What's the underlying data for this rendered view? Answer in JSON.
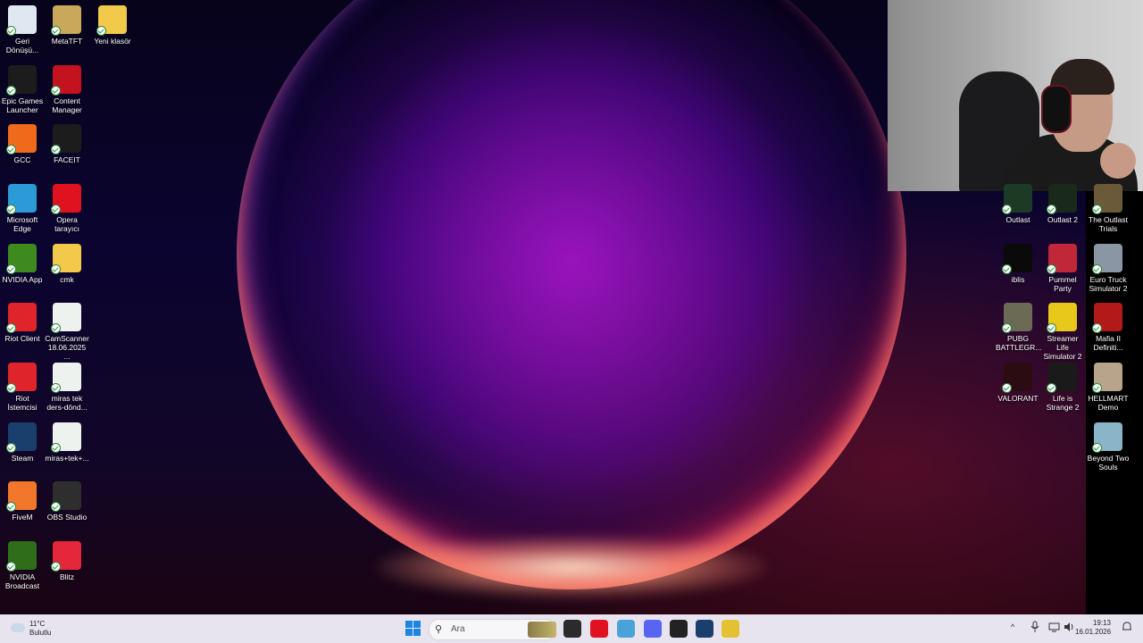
{
  "desktop": {
    "left_icons": [
      {
        "label": "Geri Dönüşü...",
        "icon": "recycle-bin-icon",
        "color": "#dfe8f0"
      },
      {
        "label": "MetaTFT",
        "icon": "metatft-icon",
        "color": "#c8a85a"
      },
      {
        "label": "Yeni klasör",
        "icon": "folder-icon",
        "color": "#f3c94b"
      },
      {
        "label": "Epic Games Launcher",
        "icon": "epic-games-icon",
        "color": "#1c1c1c"
      },
      {
        "label": "Content Manager",
        "icon": "content-manager-icon",
        "color": "#c4121f"
      },
      {
        "label": "GCC",
        "icon": "gcc-icon",
        "color": "#f06a1c"
      },
      {
        "label": "FACEIT",
        "icon": "faceit-icon",
        "color": "#1c1c1c"
      },
      {
        "label": "Microsoft Edge",
        "icon": "edge-icon",
        "color": "#2c9ad6"
      },
      {
        "label": "Opera tarayıcı",
        "icon": "opera-icon",
        "color": "#e0121f"
      },
      {
        "label": "NVIDIA App",
        "icon": "nvidia-icon",
        "color": "#3e8a1e"
      },
      {
        "label": "cmk",
        "icon": "folder-icon",
        "color": "#f3c94b"
      },
      {
        "label": "Riot Client",
        "icon": "riot-icon",
        "color": "#e0242c"
      },
      {
        "label": "CamScanner 18.06.2025 ...",
        "icon": "document-icon",
        "color": "#eef2ee"
      },
      {
        "label": "Riot İstemcisi",
        "icon": "riot-icon",
        "color": "#e0242c"
      },
      {
        "label": "miras tek ders-dönd...",
        "icon": "document-icon",
        "color": "#eef2ee"
      },
      {
        "label": "Steam",
        "icon": "steam-icon",
        "color": "#1b3f6c"
      },
      {
        "label": "miras+tek+...",
        "icon": "document-icon",
        "color": "#eef2ee"
      },
      {
        "label": "FiveM",
        "icon": "fivem-icon",
        "color": "#f2772a"
      },
      {
        "label": "OBS Studio",
        "icon": "obs-icon",
        "color": "#2e2e2e"
      },
      {
        "label": "NVIDIA Broadcast",
        "icon": "nvidia-broadcast-icon",
        "color": "#2f6d1a"
      },
      {
        "label": "Blitz",
        "icon": "blitz-icon",
        "color": "#e5273b"
      }
    ],
    "right_icons": [
      {
        "label": "Outlast",
        "icon": "outlast-icon",
        "color": "#1c3a26"
      },
      {
        "label": "Outlast 2",
        "icon": "outlast2-icon",
        "color": "#1a2a1a"
      },
      {
        "label": "The Outlast Trials",
        "icon": "outlast-trials-icon",
        "color": "#6a5a3a"
      },
      {
        "label": "iblis",
        "icon": "iblis-icon",
        "color": "#0a0a0a"
      },
      {
        "label": "Pummel Party",
        "icon": "pummel-party-icon",
        "color": "#c0283a"
      },
      {
        "label": "Euro Truck Simulator 2",
        "icon": "ets2-icon",
        "color": "#8a96a4"
      },
      {
        "label": "PUBG BATTLEGR...",
        "icon": "pubg-icon",
        "color": "#6b6b55"
      },
      {
        "label": "Streamer Life Simulator 2",
        "icon": "streamer-life-icon",
        "color": "#e8c81a"
      },
      {
        "label": "Mafia II Definiti...",
        "icon": "mafia-icon",
        "color": "#b21a1a"
      },
      {
        "label": "VALORANT",
        "icon": "valorant-icon",
        "color": "#2a0c12"
      },
      {
        "label": "Life is Strange 2",
        "icon": "life-is-strange-icon",
        "color": "#1a1a1a"
      },
      {
        "label": "HELLMART Demo",
        "icon": "hellmart-icon",
        "color": "#b8a48a"
      },
      {
        "label": "Beyond Two Souls",
        "icon": "beyond-two-souls-icon",
        "color": "#8ab4c8"
      }
    ]
  },
  "taskbar": {
    "weather": {
      "temp": "11°C",
      "condition": "Bulutlu"
    },
    "search_placeholder": "Ara",
    "pinned": [
      {
        "icon": "file-explorer-icon",
        "color": "#2b2b2b"
      },
      {
        "icon": "opera-icon",
        "color": "#e0121f"
      },
      {
        "icon": "app-icon",
        "color": "#4aa3d8"
      },
      {
        "icon": "discord-icon",
        "color": "#5865f2"
      },
      {
        "icon": "obs-icon",
        "color": "#222222"
      },
      {
        "icon": "steam-icon",
        "color": "#1b3f6c"
      },
      {
        "icon": "fivem-icon",
        "color": "#e3c133"
      }
    ],
    "tray": {
      "chevron": "^"
    },
    "clock": {
      "time": "19:13",
      "date": "16.01.2026"
    }
  }
}
